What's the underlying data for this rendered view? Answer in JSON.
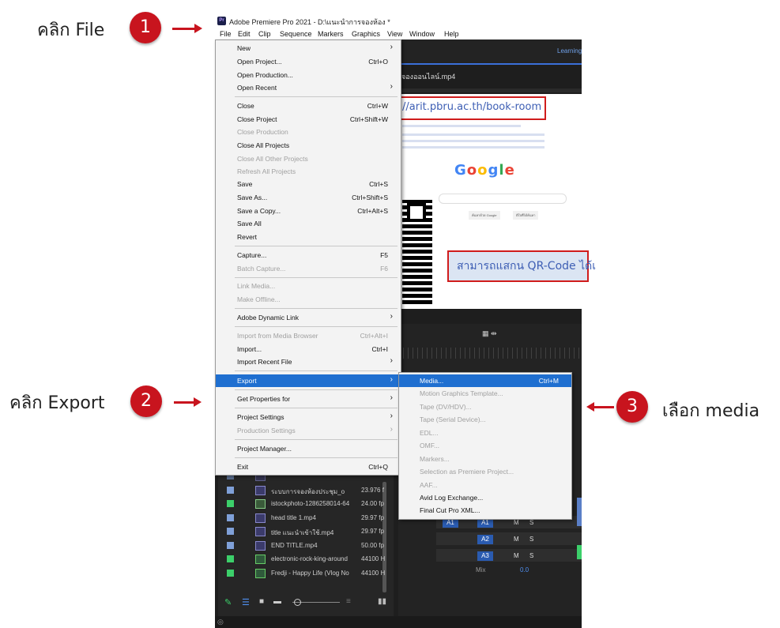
{
  "annotations": {
    "step1": {
      "text": "คลิก File",
      "number": "1"
    },
    "step2": {
      "text": "คลิก Export",
      "number": "2"
    },
    "step3": {
      "text": "เลือก media",
      "number": "3"
    }
  },
  "window": {
    "logo": "Pr",
    "title": "Adobe Premiere Pro 2021 - D:\\แนะนำการจองห้อง *"
  },
  "menubar": [
    "File",
    "Edit",
    "Clip",
    "Sequence",
    "Markers",
    "Graphics",
    "View",
    "Window",
    "Help"
  ],
  "right_panel": {
    "learning": "Learning",
    "tab_label": "จองออนไลน์.mp4"
  },
  "file_menu": [
    {
      "label": "New",
      "shortcut": "",
      "submenu": true,
      "disabled": false
    },
    {
      "label": "Open Project...",
      "shortcut": "Ctrl+O",
      "submenu": false,
      "disabled": false
    },
    {
      "label": "Open Production...",
      "shortcut": "",
      "submenu": false,
      "disabled": false
    },
    {
      "label": "Open Recent",
      "shortcut": "",
      "submenu": true,
      "disabled": false
    },
    {
      "label": "Close",
      "shortcut": "Ctrl+W",
      "submenu": false,
      "disabled": false
    },
    {
      "label": "Close Project",
      "shortcut": "Ctrl+Shift+W",
      "submenu": false,
      "disabled": false
    },
    {
      "label": "Close Production",
      "shortcut": "",
      "submenu": false,
      "disabled": true
    },
    {
      "label": "Close All Projects",
      "shortcut": "",
      "submenu": false,
      "disabled": false
    },
    {
      "label": "Close All Other Projects",
      "shortcut": "",
      "submenu": false,
      "disabled": true
    },
    {
      "label": "Refresh All Projects",
      "shortcut": "",
      "submenu": false,
      "disabled": true
    },
    {
      "label": "Save",
      "shortcut": "Ctrl+S",
      "submenu": false,
      "disabled": false
    },
    {
      "label": "Save As...",
      "shortcut": "Ctrl+Shift+S",
      "submenu": false,
      "disabled": false
    },
    {
      "label": "Save a Copy...",
      "shortcut": "Ctrl+Alt+S",
      "submenu": false,
      "disabled": false
    },
    {
      "label": "Save All",
      "shortcut": "",
      "submenu": false,
      "disabled": false
    },
    {
      "label": "Revert",
      "shortcut": "",
      "submenu": false,
      "disabled": false
    },
    {
      "label": "Capture...",
      "shortcut": "F5",
      "submenu": false,
      "disabled": false
    },
    {
      "label": "Batch Capture...",
      "shortcut": "F6",
      "submenu": false,
      "disabled": true
    },
    {
      "label": "Link Media...",
      "shortcut": "",
      "submenu": false,
      "disabled": true
    },
    {
      "label": "Make Offline...",
      "shortcut": "",
      "submenu": false,
      "disabled": true
    },
    {
      "label": "Adobe Dynamic Link",
      "shortcut": "",
      "submenu": true,
      "disabled": false
    },
    {
      "label": "Import from Media Browser",
      "shortcut": "Ctrl+Alt+I",
      "submenu": false,
      "disabled": true
    },
    {
      "label": "Import...",
      "shortcut": "Ctrl+I",
      "submenu": false,
      "disabled": false
    },
    {
      "label": "Import Recent File",
      "shortcut": "",
      "submenu": true,
      "disabled": false
    },
    {
      "label": "Export",
      "shortcut": "",
      "submenu": true,
      "disabled": false,
      "highlighted": true
    },
    {
      "label": "Get Properties for",
      "shortcut": "",
      "submenu": true,
      "disabled": false
    },
    {
      "label": "Project Settings",
      "shortcut": "",
      "submenu": true,
      "disabled": false
    },
    {
      "label": "Production Settings",
      "shortcut": "",
      "submenu": true,
      "disabled": true
    },
    {
      "label": "Project Manager...",
      "shortcut": "",
      "submenu": false,
      "disabled": false
    },
    {
      "label": "Exit",
      "shortcut": "Ctrl+Q",
      "submenu": false,
      "disabled": false
    }
  ],
  "export_menu": [
    {
      "label": "Media...",
      "shortcut": "Ctrl+M",
      "disabled": false,
      "highlighted": true
    },
    {
      "label": "Motion Graphics Template...",
      "shortcut": "",
      "disabled": true
    },
    {
      "label": "Tape (DV/HDV)...",
      "shortcut": "",
      "disabled": true
    },
    {
      "label": "Tape (Serial Device)...",
      "shortcut": "",
      "disabled": true
    },
    {
      "label": "EDL...",
      "shortcut": "",
      "disabled": true
    },
    {
      "label": "OMF...",
      "shortcut": "",
      "disabled": true
    },
    {
      "label": "Markers...",
      "shortcut": "",
      "disabled": true
    },
    {
      "label": "Selection as Premiere Project...",
      "shortcut": "",
      "disabled": true
    },
    {
      "label": "AAF...",
      "shortcut": "",
      "disabled": true
    },
    {
      "label": "Avid Log Exchange...",
      "shortcut": "",
      "disabled": false
    },
    {
      "label": "Final Cut Pro XML...",
      "shortcut": "",
      "disabled": false
    }
  ],
  "preview": {
    "url": "//arit.pbru.ac.th/book-room",
    "qr_caption": "สามารถแสกน QR-Code ได้เ",
    "google_buttons": [
      "ค้นหาด้วย Google",
      "ดีใจที่ได้ค้นหา"
    ]
  },
  "project_files": [
    {
      "name": "ระบบการจองห้องประชุม_o",
      "fps": "23.976 f",
      "swatch": "#7fa0d8"
    },
    {
      "name": "istockphoto-1286258014-64",
      "fps": "24.00 fp",
      "swatch": "#3ccf6a"
    },
    {
      "name": "head title 1.mp4",
      "fps": "29.97 fp",
      "swatch": "#7fa0d8"
    },
    {
      "name": "title แนะนำเข้าใช้.mp4",
      "fps": "29.97 fp",
      "swatch": "#7fa0d8"
    },
    {
      "name": "END TITLE.mp4",
      "fps": "50.00 fp",
      "swatch": "#7fa0d8"
    },
    {
      "name": "electronic-rock-king-around",
      "fps": "44100 H",
      "swatch": "#3ccf6a"
    },
    {
      "name": "Fredji - Happy Life (Vlog No",
      "fps": "44100 H",
      "swatch": "#3ccf6a"
    }
  ],
  "tracks": {
    "a1": "A1",
    "a2": "A2",
    "a3": "A3",
    "m": "M",
    "s": "S",
    "mix": "Mix",
    "mix_value": "0.0"
  },
  "colors": {
    "accent_red": "#c8141e",
    "menu_highlight": "#1f6fd0",
    "url_blue": "#3d5eb4"
  }
}
